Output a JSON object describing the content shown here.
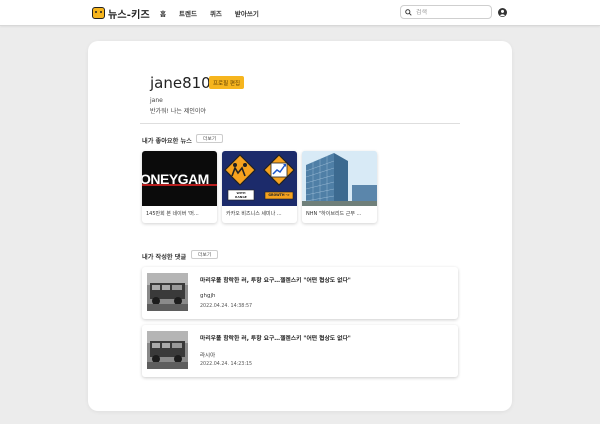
{
  "header": {
    "logo_text": "뉴스-키즈",
    "nav": [
      "홈",
      "트렌드",
      "퀴즈",
      "받아쓰기"
    ],
    "search_placeholder": "검색"
  },
  "profile": {
    "username": "jane810",
    "edit_label": "프로필 편집",
    "nickname": "jane",
    "bio": "반가워! 나는 제인이야"
  },
  "liked_news": {
    "title": "내가 좋아요한 뉴스",
    "more_label": "더보기",
    "items": [
      {
        "caption": "145만회 본 네이버 '머...",
        "thumb_text": "ONEYGAM"
      },
      {
        "caption": "카카오 비즈니스 세미나 ...",
        "sign_left": "WITH\nRANGE",
        "sign_right": "GROWTH ->"
      },
      {
        "caption": "NHN \"하이브리드 근무 ..."
      }
    ]
  },
  "my_comments": {
    "title": "내가 작성한 댓글",
    "more_label": "더보기",
    "items": [
      {
        "title": "마리우폴 함락한 러, 투항 요구…젤렌스키 \"어떤 협상도 없다\"",
        "body": "ghgjh",
        "date": "2022.04.24. 14:38:57"
      },
      {
        "title": "마리우폴 함락한 러, 투항 요구…젤렌스키 \"어떤 협상도 없다\"",
        "body": "라시아",
        "date": "2022.04.24. 14:23:15"
      }
    ]
  },
  "colors": {
    "accent": "#f6b51e",
    "background": "#ececec",
    "card": "#ffffff"
  }
}
